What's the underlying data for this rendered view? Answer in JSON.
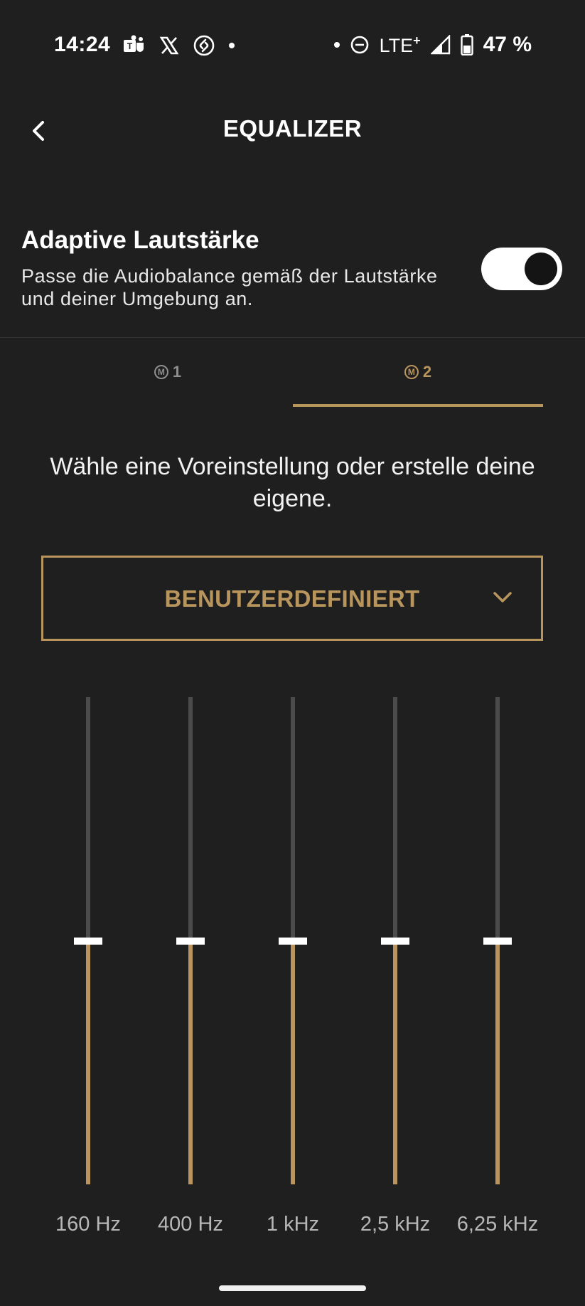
{
  "status_bar": {
    "time": "14:24",
    "network": "LTE",
    "network_sup": "+",
    "battery": "47 %",
    "icons": [
      "teams-icon",
      "x-icon",
      "shazam-icon",
      "dnd-icon",
      "signal-icon",
      "battery-icon"
    ]
  },
  "header": {
    "title": "EQUALIZER"
  },
  "adaptive": {
    "title": "Adaptive Lautstärke",
    "description": "Passe die Audiobalance gemäß der Lautstärke und deiner Umgebung an.",
    "enabled": true
  },
  "tabs": [
    {
      "badge": "M",
      "label": "1",
      "active": false
    },
    {
      "badge": "M",
      "label": "2",
      "active": true
    }
  ],
  "instruction": "Wähle eine Voreinstellung oder erstelle deine eigene.",
  "preset": {
    "selected": "BENUTZERDEFINIERT"
  },
  "equalizer": {
    "bands": [
      {
        "label": "160 Hz",
        "level": 0.5
      },
      {
        "label": "400 Hz",
        "level": 0.5
      },
      {
        "label": "1 kHz",
        "level": 0.5
      },
      {
        "label": "2,5 kHz",
        "level": 0.5
      },
      {
        "label": "6,25 kHz",
        "level": 0.5
      }
    ]
  },
  "colors": {
    "accent": "#b8955c",
    "background": "#1f1f1f",
    "track": "#4b4b4b"
  }
}
